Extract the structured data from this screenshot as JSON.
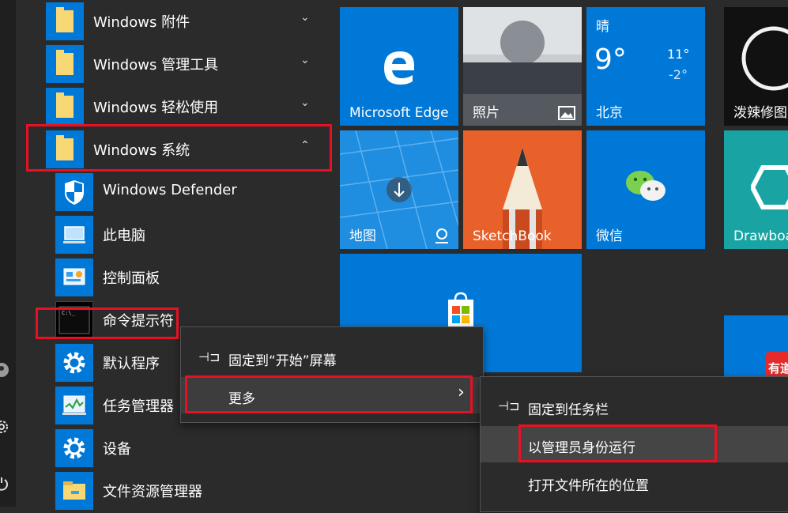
{
  "folders": [
    {
      "label": "Windows 附件",
      "chevron": "⌄"
    },
    {
      "label": "Windows 管理工具",
      "chevron": "⌄"
    },
    {
      "label": "Windows 轻松使用",
      "chevron": "⌄"
    },
    {
      "label": "Windows 系统",
      "chevron": "⌃"
    }
  ],
  "system_items": [
    {
      "label": "Windows Defender",
      "icon": "shield-icon"
    },
    {
      "label": "此电脑",
      "icon": "computer-icon"
    },
    {
      "label": "控制面板",
      "icon": "control-panel-icon"
    },
    {
      "label": "命令提示符",
      "icon": "command-prompt-icon"
    },
    {
      "label": "默认程序",
      "icon": "gear-icon"
    },
    {
      "label": "任务管理器",
      "icon": "task-manager-icon"
    },
    {
      "label": "设备",
      "icon": "gear-icon"
    },
    {
      "label": "文件资源管理器",
      "icon": "folder-icon"
    }
  ],
  "tiles": {
    "edge": "Microsoft Edge",
    "photos": "照片",
    "weather": {
      "condition": "晴",
      "temp": "9°",
      "high": "11°",
      "low": "-2°",
      "city": "北京"
    },
    "splash": "泼辣修图",
    "maps": "地图",
    "sketchbook": "SketchBook",
    "wechat": "微信",
    "drawboard": "Drawboa",
    "partial_badge": "有道"
  },
  "context_menu": {
    "pin_start": "固定到“开始”屏幕",
    "more": "更多",
    "more_arrow": "›"
  },
  "submenu": {
    "pin_taskbar": "固定到任务栏",
    "run_as_admin": "以管理员身份运行",
    "open_location": "打开文件所在的位置"
  },
  "colors": {
    "accent": "#0078d7",
    "highlight": "#e81123",
    "menu_bg": "#2b2b2b"
  }
}
